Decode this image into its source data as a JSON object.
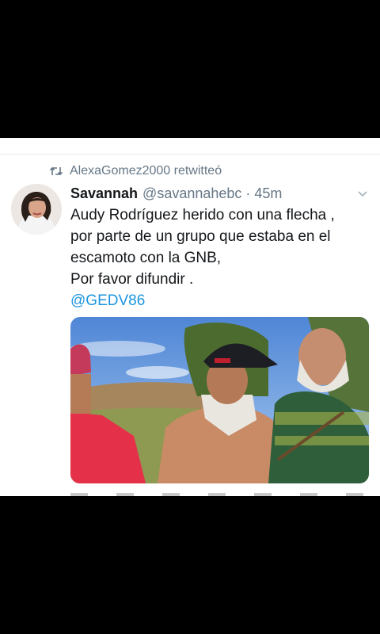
{
  "retweet": {
    "icon": "retweet-icon",
    "text": "AlexaGomez2000 retwitteó"
  },
  "tweet": {
    "author_name": "Savannah",
    "author_handle": "@savannahebc",
    "separator": "·",
    "time": "45m",
    "lines": [
      "Audy Rodríguez herido con una flecha ,",
      "por parte de un grupo que estaba en el",
      "escamoto con la GNB,",
      "Por favor difundir ."
    ],
    "mention": "@GEDV86",
    "menu_icon": "chevron-down-icon"
  },
  "colors": {
    "background": "#000000",
    "card": "#ffffff",
    "secondary_text": "#657786",
    "link": "#1b95e0"
  }
}
